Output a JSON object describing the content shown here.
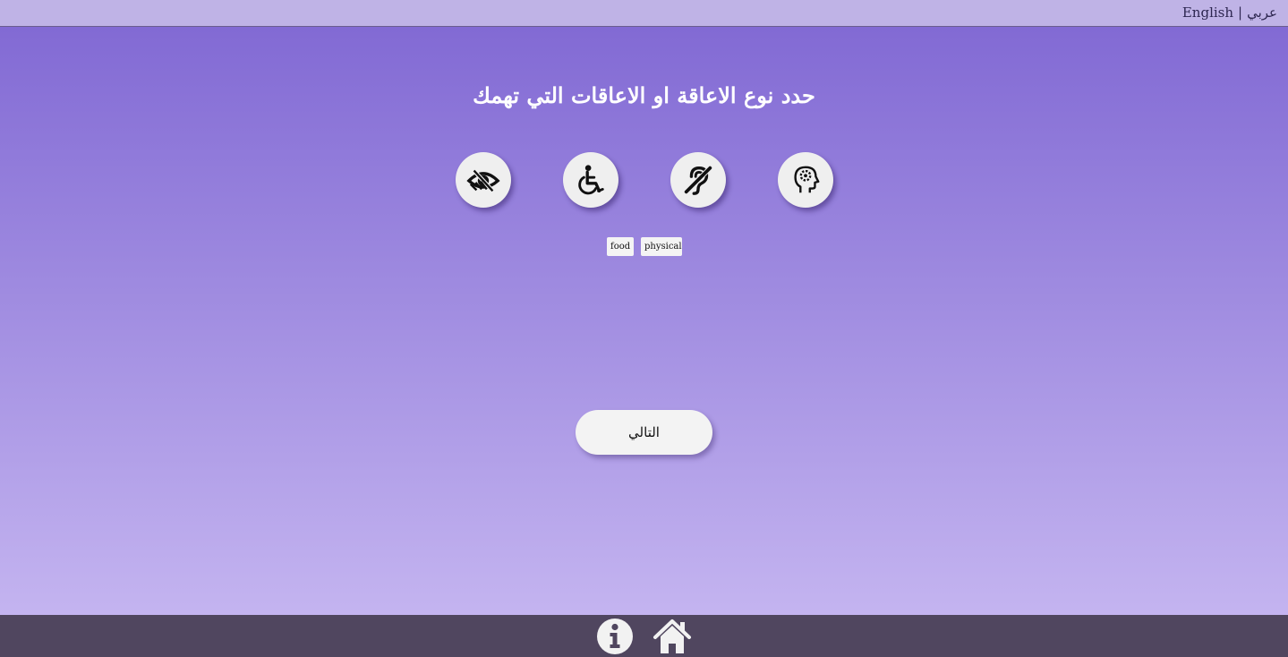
{
  "header": {
    "lang_arabic": "عربي",
    "lang_separator": "|",
    "lang_english": "English"
  },
  "main": {
    "title": "حدد نوع الاعاقة او الاعاقات التي تهمك",
    "disabilities": [
      {
        "icon": "cognitive-head-gear-icon"
      },
      {
        "icon": "hearing-impaired-icon"
      },
      {
        "icon": "wheelchair-icon"
      },
      {
        "icon": "visual-impairment-eye-icon"
      }
    ],
    "selected_tags": [
      "food",
      "physical"
    ],
    "next_label": "التالي"
  },
  "footer": {
    "icons": [
      "info-icon",
      "home-icon"
    ]
  },
  "colors": {
    "topbar": "#bfb3e6",
    "gradient_top": "#826ad4",
    "gradient_bottom": "#c4b4f0",
    "footer": "#50465f",
    "button_bg": "#f3f3f3"
  }
}
